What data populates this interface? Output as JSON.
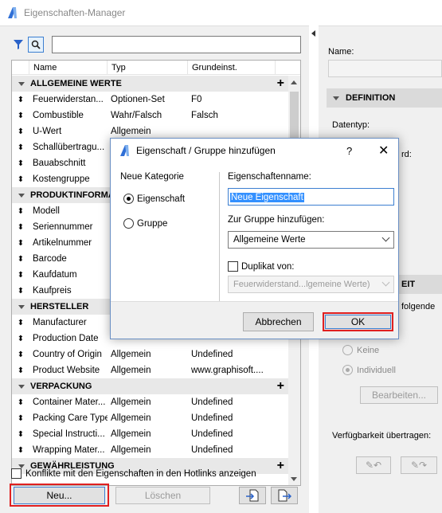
{
  "window_title": "Eigenschaften-Manager",
  "table": {
    "headers": [
      "Name",
      "Typ",
      "Grundeinst."
    ],
    "groups": [
      {
        "name": "ALLGEMEINE WERTE",
        "has_add": true,
        "rows": [
          [
            "Feuerwiderstan...",
            "Optionen-Set",
            "F0"
          ],
          [
            "Combustible",
            "Wahr/Falsch",
            "Falsch"
          ],
          [
            "U-Wert",
            "Allgemein",
            ""
          ],
          [
            "Schallübertragu...",
            "",
            ""
          ],
          [
            "Bauabschnitt",
            "",
            ""
          ],
          [
            "Kostengruppe",
            "",
            ""
          ]
        ]
      },
      {
        "name": "PRODUKTINFORMA...",
        "has_add": false,
        "rows": [
          [
            "Modell",
            "",
            ""
          ],
          [
            "Seriennummer",
            "",
            ""
          ],
          [
            "Artikelnummer",
            "",
            ""
          ],
          [
            "Barcode",
            "",
            ""
          ],
          [
            "Kaufdatum",
            "",
            ""
          ],
          [
            "Kaufpreis",
            "",
            ""
          ]
        ]
      },
      {
        "name": "HERSTELLER",
        "has_add": false,
        "rows": [
          [
            "Manufacturer",
            "",
            ""
          ],
          [
            "Production Date",
            "",
            ""
          ],
          [
            "Country of Origin",
            "Allgemein",
            "Undefined"
          ],
          [
            "Product Website",
            "Allgemein",
            "www.graphisoft...."
          ]
        ]
      },
      {
        "name": "VERPACKUNG",
        "has_add": true,
        "rows": [
          [
            "Container Mater...",
            "Allgemein",
            "Undefined"
          ],
          [
            "Packing Care Type",
            "Allgemein",
            "Undefined"
          ],
          [
            "Special Instructi...",
            "Allgemein",
            "Undefined"
          ],
          [
            "Wrapping Mater...",
            "Allgemein",
            "Undefined"
          ]
        ]
      },
      {
        "name": "GEWÄHRLEISTUNG",
        "has_add": true,
        "rows": []
      }
    ]
  },
  "hotlink_checkbox": "Konflikte mit den Eigenschaften in den Hotlinks anzeigen",
  "buttons": {
    "new": "Neu...",
    "delete": "Löschen"
  },
  "right_panel": {
    "name_label": "Name:",
    "definition": "DEFINITION",
    "datatype_label": "Datentyp:",
    "partial_rd": "rd:",
    "partial_eit": "EIT",
    "partial_folgende": "folgende",
    "radio_none": "Keine",
    "radio_individual": "Individuell",
    "edit_button": "Bearbeiten...",
    "transfer_label": "Verfügbarkeit übertragen:"
  },
  "dialog": {
    "title": "Eigenschaft / Gruppe hinzufügen",
    "help": "?",
    "close": "✕",
    "category_label": "Neue Kategorie",
    "option_property": "Eigenschaft",
    "option_group": "Gruppe",
    "property_name_label": "Eigenschaftenname:",
    "property_name_value": "Neue Eigenschaft",
    "group_label": "Zur Gruppe hinzufügen:",
    "group_value": "Allgemeine Werte",
    "duplicate_label": "Duplikat von:",
    "duplicate_value": "Feuerwiderstand...lgemeine Werte)",
    "cancel": "Abbrechen",
    "ok": "OK"
  }
}
